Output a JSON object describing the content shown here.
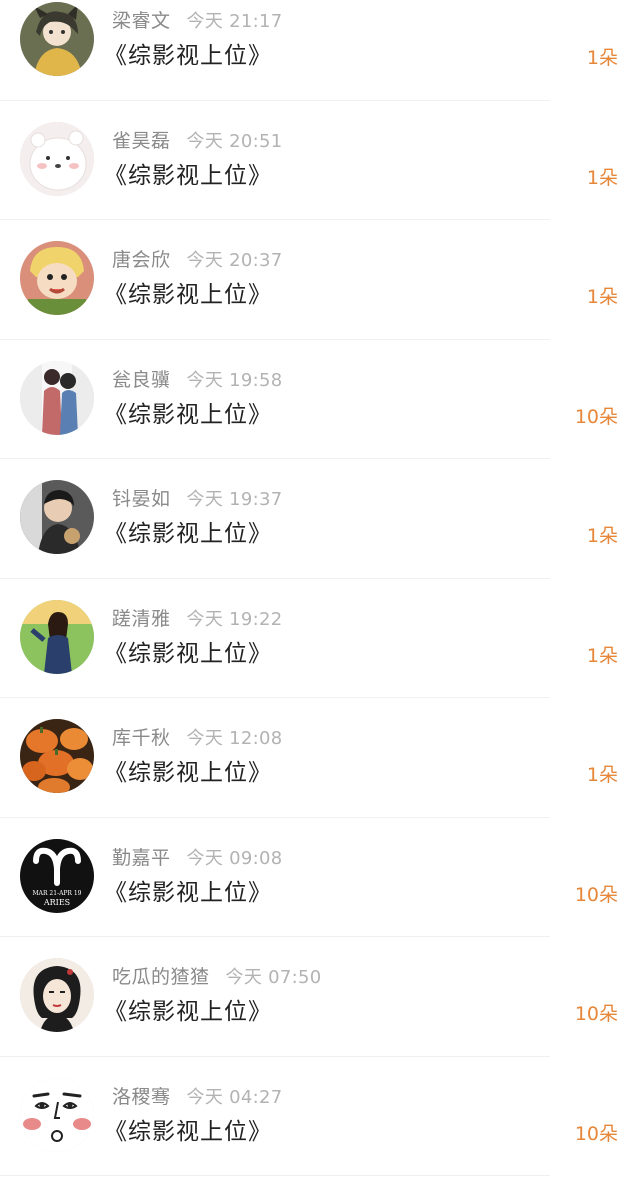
{
  "comments": [
    {
      "name": "梁睿文",
      "time": "今天 21:17",
      "title": "《综影视上位》",
      "amount": "1朵",
      "avatar_bg": "#6b6f52",
      "avatar_fg": "#e0b64a",
      "avatar_icon": "cartoon-girl-icon"
    },
    {
      "name": "雀昊磊",
      "time": "今天 20:51",
      "title": "《综影视上位》",
      "amount": "1朵",
      "avatar_bg": "#f4eeee",
      "avatar_fg": "#ffffff",
      "avatar_icon": "white-bear-icon"
    },
    {
      "name": "唐会欣",
      "time": "今天 20:37",
      "title": "《综影视上位》",
      "amount": "1朵",
      "avatar_bg": "#d98f7a",
      "avatar_fg": "#f0d36a",
      "avatar_icon": "cartoon-character-icon"
    },
    {
      "name": "瓮良骥",
      "time": "今天 19:58",
      "title": "《综影视上位》",
      "amount": "10朵",
      "avatar_bg": "#ececec",
      "avatar_fg": "#c26a6a",
      "avatar_icon": "couple-photo-icon"
    },
    {
      "name": "钭晏如",
      "time": "今天 19:37",
      "title": "《综影视上位》",
      "amount": "1朵",
      "avatar_bg": "#5a5a5a",
      "avatar_fg": "#d9d9d9",
      "avatar_icon": "man-photo-icon"
    },
    {
      "name": "蹉清雅",
      "time": "今天 19:22",
      "title": "《综影视上位》",
      "amount": "1朵",
      "avatar_bg": "#8cc35f",
      "avatar_fg": "#2a3f6b",
      "avatar_icon": "girl-photo-icon"
    },
    {
      "name": "库千秋",
      "time": "今天 12:08",
      "title": "《综影视上位》",
      "amount": "1朵",
      "avatar_bg": "#3a2414",
      "avatar_fg": "#e4772a",
      "avatar_icon": "pumpkins-icon"
    },
    {
      "name": "勤嘉平",
      "time": "今天 09:08",
      "title": "《综影视上位》",
      "amount": "10朵",
      "avatar_bg": "#111111",
      "avatar_fg": "#ffffff",
      "avatar_icon": "aries-icon",
      "avatar_text_1": "MAR 21-APR 19",
      "avatar_text_2": "ARIES"
    },
    {
      "name": "吃瓜的猹猹",
      "time": "今天 07:50",
      "title": "《综影视上位》",
      "amount": "10朵",
      "avatar_bg": "#f3ece4",
      "avatar_fg": "#1d1d1d",
      "avatar_icon": "ink-girl-icon"
    },
    {
      "name": "洛稷骞",
      "time": "今天 04:27",
      "title": "《综影视上位》",
      "amount": "10朵",
      "avatar_bg": "#ffffff",
      "avatar_fg": "#e98a8a",
      "avatar_icon": "blush-face-icon"
    }
  ],
  "colors": {
    "amount": "#e6873a",
    "name": "#8a8a8a",
    "time": "#b3b3b3",
    "title": "#222222",
    "divider": "#f0f0f0"
  }
}
